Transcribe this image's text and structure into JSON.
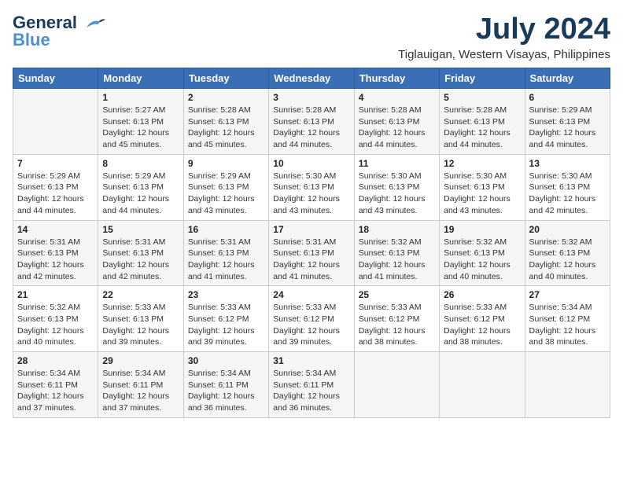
{
  "header": {
    "logo_line1": "General",
    "logo_line2": "Blue",
    "month": "July 2024",
    "location": "Tiglauigan, Western Visayas, Philippines"
  },
  "columns": [
    "Sunday",
    "Monday",
    "Tuesday",
    "Wednesday",
    "Thursday",
    "Friday",
    "Saturday"
  ],
  "weeks": [
    [
      {
        "day": "",
        "info": ""
      },
      {
        "day": "1",
        "info": "Sunrise: 5:27 AM\nSunset: 6:13 PM\nDaylight: 12 hours\nand 45 minutes."
      },
      {
        "day": "2",
        "info": "Sunrise: 5:28 AM\nSunset: 6:13 PM\nDaylight: 12 hours\nand 45 minutes."
      },
      {
        "day": "3",
        "info": "Sunrise: 5:28 AM\nSunset: 6:13 PM\nDaylight: 12 hours\nand 44 minutes."
      },
      {
        "day": "4",
        "info": "Sunrise: 5:28 AM\nSunset: 6:13 PM\nDaylight: 12 hours\nand 44 minutes."
      },
      {
        "day": "5",
        "info": "Sunrise: 5:28 AM\nSunset: 6:13 PM\nDaylight: 12 hours\nand 44 minutes."
      },
      {
        "day": "6",
        "info": "Sunrise: 5:29 AM\nSunset: 6:13 PM\nDaylight: 12 hours\nand 44 minutes."
      }
    ],
    [
      {
        "day": "7",
        "info": "Sunrise: 5:29 AM\nSunset: 6:13 PM\nDaylight: 12 hours\nand 44 minutes."
      },
      {
        "day": "8",
        "info": "Sunrise: 5:29 AM\nSunset: 6:13 PM\nDaylight: 12 hours\nand 44 minutes."
      },
      {
        "day": "9",
        "info": "Sunrise: 5:29 AM\nSunset: 6:13 PM\nDaylight: 12 hours\nand 43 minutes."
      },
      {
        "day": "10",
        "info": "Sunrise: 5:30 AM\nSunset: 6:13 PM\nDaylight: 12 hours\nand 43 minutes."
      },
      {
        "day": "11",
        "info": "Sunrise: 5:30 AM\nSunset: 6:13 PM\nDaylight: 12 hours\nand 43 minutes."
      },
      {
        "day": "12",
        "info": "Sunrise: 5:30 AM\nSunset: 6:13 PM\nDaylight: 12 hours\nand 43 minutes."
      },
      {
        "day": "13",
        "info": "Sunrise: 5:30 AM\nSunset: 6:13 PM\nDaylight: 12 hours\nand 42 minutes."
      }
    ],
    [
      {
        "day": "14",
        "info": "Sunrise: 5:31 AM\nSunset: 6:13 PM\nDaylight: 12 hours\nand 42 minutes."
      },
      {
        "day": "15",
        "info": "Sunrise: 5:31 AM\nSunset: 6:13 PM\nDaylight: 12 hours\nand 42 minutes."
      },
      {
        "day": "16",
        "info": "Sunrise: 5:31 AM\nSunset: 6:13 PM\nDaylight: 12 hours\nand 41 minutes."
      },
      {
        "day": "17",
        "info": "Sunrise: 5:31 AM\nSunset: 6:13 PM\nDaylight: 12 hours\nand 41 minutes."
      },
      {
        "day": "18",
        "info": "Sunrise: 5:32 AM\nSunset: 6:13 PM\nDaylight: 12 hours\nand 41 minutes."
      },
      {
        "day": "19",
        "info": "Sunrise: 5:32 AM\nSunset: 6:13 PM\nDaylight: 12 hours\nand 40 minutes."
      },
      {
        "day": "20",
        "info": "Sunrise: 5:32 AM\nSunset: 6:13 PM\nDaylight: 12 hours\nand 40 minutes."
      }
    ],
    [
      {
        "day": "21",
        "info": "Sunrise: 5:32 AM\nSunset: 6:13 PM\nDaylight: 12 hours\nand 40 minutes."
      },
      {
        "day": "22",
        "info": "Sunrise: 5:33 AM\nSunset: 6:13 PM\nDaylight: 12 hours\nand 39 minutes."
      },
      {
        "day": "23",
        "info": "Sunrise: 5:33 AM\nSunset: 6:12 PM\nDaylight: 12 hours\nand 39 minutes."
      },
      {
        "day": "24",
        "info": "Sunrise: 5:33 AM\nSunset: 6:12 PM\nDaylight: 12 hours\nand 39 minutes."
      },
      {
        "day": "25",
        "info": "Sunrise: 5:33 AM\nSunset: 6:12 PM\nDaylight: 12 hours\nand 38 minutes."
      },
      {
        "day": "26",
        "info": "Sunrise: 5:33 AM\nSunset: 6:12 PM\nDaylight: 12 hours\nand 38 minutes."
      },
      {
        "day": "27",
        "info": "Sunrise: 5:34 AM\nSunset: 6:12 PM\nDaylight: 12 hours\nand 38 minutes."
      }
    ],
    [
      {
        "day": "28",
        "info": "Sunrise: 5:34 AM\nSunset: 6:11 PM\nDaylight: 12 hours\nand 37 minutes."
      },
      {
        "day": "29",
        "info": "Sunrise: 5:34 AM\nSunset: 6:11 PM\nDaylight: 12 hours\nand 37 minutes."
      },
      {
        "day": "30",
        "info": "Sunrise: 5:34 AM\nSunset: 6:11 PM\nDaylight: 12 hours\nand 36 minutes."
      },
      {
        "day": "31",
        "info": "Sunrise: 5:34 AM\nSunset: 6:11 PM\nDaylight: 12 hours\nand 36 minutes."
      },
      {
        "day": "",
        "info": ""
      },
      {
        "day": "",
        "info": ""
      },
      {
        "day": "",
        "info": ""
      }
    ]
  ]
}
